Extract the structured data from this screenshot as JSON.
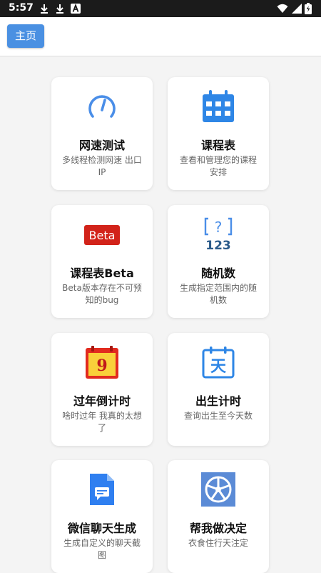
{
  "status_bar": {
    "time": "5:57",
    "icons": [
      "download-icon",
      "download-icon",
      "font-app-icon",
      "wifi-icon",
      "signal-icon",
      "battery-icon"
    ]
  },
  "app_bar": {
    "home_label": "主页"
  },
  "colors": {
    "accent": "#4a90e2",
    "card_bg": "#ffffff",
    "page_bg": "#f4f4f4"
  },
  "cards": [
    {
      "title": "网速测试",
      "desc": "多线程检测网速 出口IP",
      "icon": "speedometer-icon"
    },
    {
      "title": "课程表",
      "desc": "查看和管理您的课程安排",
      "icon": "calendar-grid-icon"
    },
    {
      "title": "课程表Beta",
      "desc": "Beta版本存在不可预知的bug",
      "icon": "beta-badge-icon",
      "badge": "Beta"
    },
    {
      "title": "随机数",
      "desc": "生成指定范围内的随机数",
      "icon": "random-number-icon",
      "icon_text_top": "?",
      "icon_text_bottom": "123"
    },
    {
      "title": "过年倒计时",
      "desc": "啥时过年 我真的太想了",
      "icon": "new-year-calendar-icon",
      "icon_number": "9"
    },
    {
      "title": "出生计时",
      "desc": "查询出生至今天数",
      "icon": "day-calendar-icon",
      "icon_char": "天"
    },
    {
      "title": "微信聊天生成",
      "desc": "生成自定义的聊天截图",
      "icon": "chat-document-icon"
    },
    {
      "title": "帮我做决定",
      "desc": "衣食住行天注定",
      "icon": "spin-wheel-icon"
    }
  ]
}
